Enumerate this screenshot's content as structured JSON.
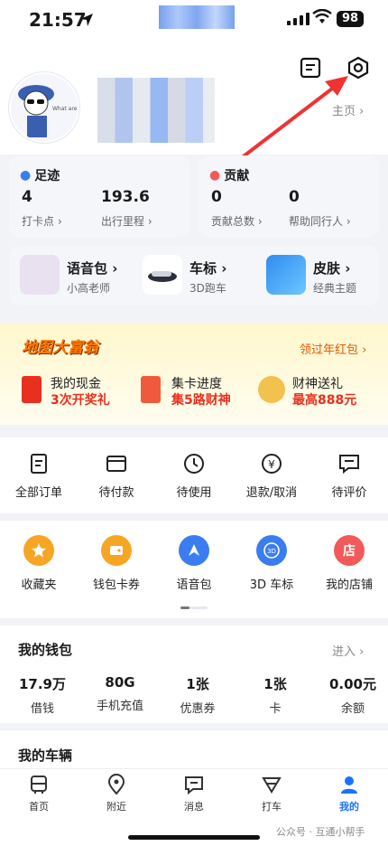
{
  "status_bar": {
    "time": "21:57",
    "battery": "98"
  },
  "header": {
    "home_link": "主页"
  },
  "stats": {
    "footprint": {
      "title": "足迹",
      "items": [
        {
          "value": "4",
          "label": "打卡点"
        },
        {
          "value": "193.6",
          "label": "出行里程"
        }
      ]
    },
    "contribution": {
      "title": "贡献",
      "items": [
        {
          "value": "0",
          "label": "贡献总数"
        },
        {
          "value": "0",
          "label": "帮助同行人"
        }
      ]
    }
  },
  "features": [
    {
      "title": "语音包",
      "sub": "小高老师"
    },
    {
      "title": "车标",
      "sub": "3D跑车"
    },
    {
      "title": "皮肤",
      "sub": "经典主题"
    }
  ],
  "promo": {
    "title": "地图大富翁",
    "link": "领过年红包",
    "items": [
      {
        "title": "我的现金",
        "sub": "3次开奖礼"
      },
      {
        "title": "集卡进度",
        "sub": "集5路财神"
      },
      {
        "title": "财神送礼",
        "sub": "最高888元"
      }
    ]
  },
  "orders": [
    {
      "label": "全部订单",
      "icon": "orders-icon"
    },
    {
      "label": "待付款",
      "icon": "wallet-icon"
    },
    {
      "label": "待使用",
      "icon": "clock-icon"
    },
    {
      "label": "退款/取消",
      "icon": "refund-icon"
    },
    {
      "label": "待评价",
      "icon": "comment-icon"
    }
  ],
  "services": [
    {
      "label": "收藏夹",
      "color": "#f6a623"
    },
    {
      "label": "钱包卡券",
      "color": "#f6a623"
    },
    {
      "label": "语音包",
      "color": "#3b7df0"
    },
    {
      "label": "3D 车标",
      "color": "#3b7df0"
    },
    {
      "label": "我的店铺",
      "color": "#f25a5a"
    }
  ],
  "wallet": {
    "title": "我的钱包",
    "more": "进入",
    "items": [
      {
        "value": "17.9万",
        "label": "借钱"
      },
      {
        "value": "80G",
        "label": "手机充值"
      },
      {
        "value": "1张",
        "label": "优惠券"
      },
      {
        "value": "1张",
        "label": "卡"
      },
      {
        "value": "0.00元",
        "label": "余额"
      }
    ]
  },
  "vehicles": {
    "title": "我的车辆"
  },
  "tabs": [
    {
      "label": "首页"
    },
    {
      "label": "附近"
    },
    {
      "label": "消息"
    },
    {
      "label": "打车"
    },
    {
      "label": "我的"
    }
  ],
  "watermark": "公众号 · 互通小帮手",
  "colors": {
    "accent": "#1a73ff",
    "red": "#e8301e",
    "orange": "#ff7a00"
  }
}
